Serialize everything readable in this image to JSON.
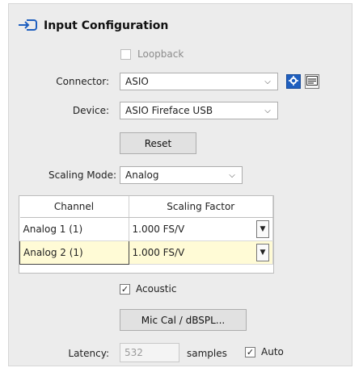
{
  "header": {
    "title": "Input Configuration",
    "icon": "input-arrow-icon"
  },
  "loopback": {
    "label": "Loopback",
    "checked": false,
    "enabled": false
  },
  "connector": {
    "label": "Connector:",
    "value": "ASIO"
  },
  "device": {
    "label": "Device:",
    "value": "ASIO Fireface USB"
  },
  "reset": {
    "label": "Reset"
  },
  "scaling": {
    "label": "Scaling Mode:",
    "value": "Analog"
  },
  "table": {
    "columns": [
      "Channel",
      "Scaling Factor"
    ],
    "rows": [
      {
        "channel": "Analog 1 (1)",
        "factor": "1.000 FS/V"
      },
      {
        "channel": "Analog 2 (1)",
        "factor": "1.000 FS/V"
      }
    ]
  },
  "acoustic": {
    "label": "Acoustic",
    "checked": true
  },
  "miccal": {
    "label": "Mic Cal / dBSPL..."
  },
  "latency": {
    "label": "Latency:",
    "value": "532",
    "unit": "samples"
  },
  "auto": {
    "label": "Auto",
    "checked": true
  },
  "colors": {
    "accent": "#1f5fbf",
    "selected_row": "#fffbd6"
  }
}
